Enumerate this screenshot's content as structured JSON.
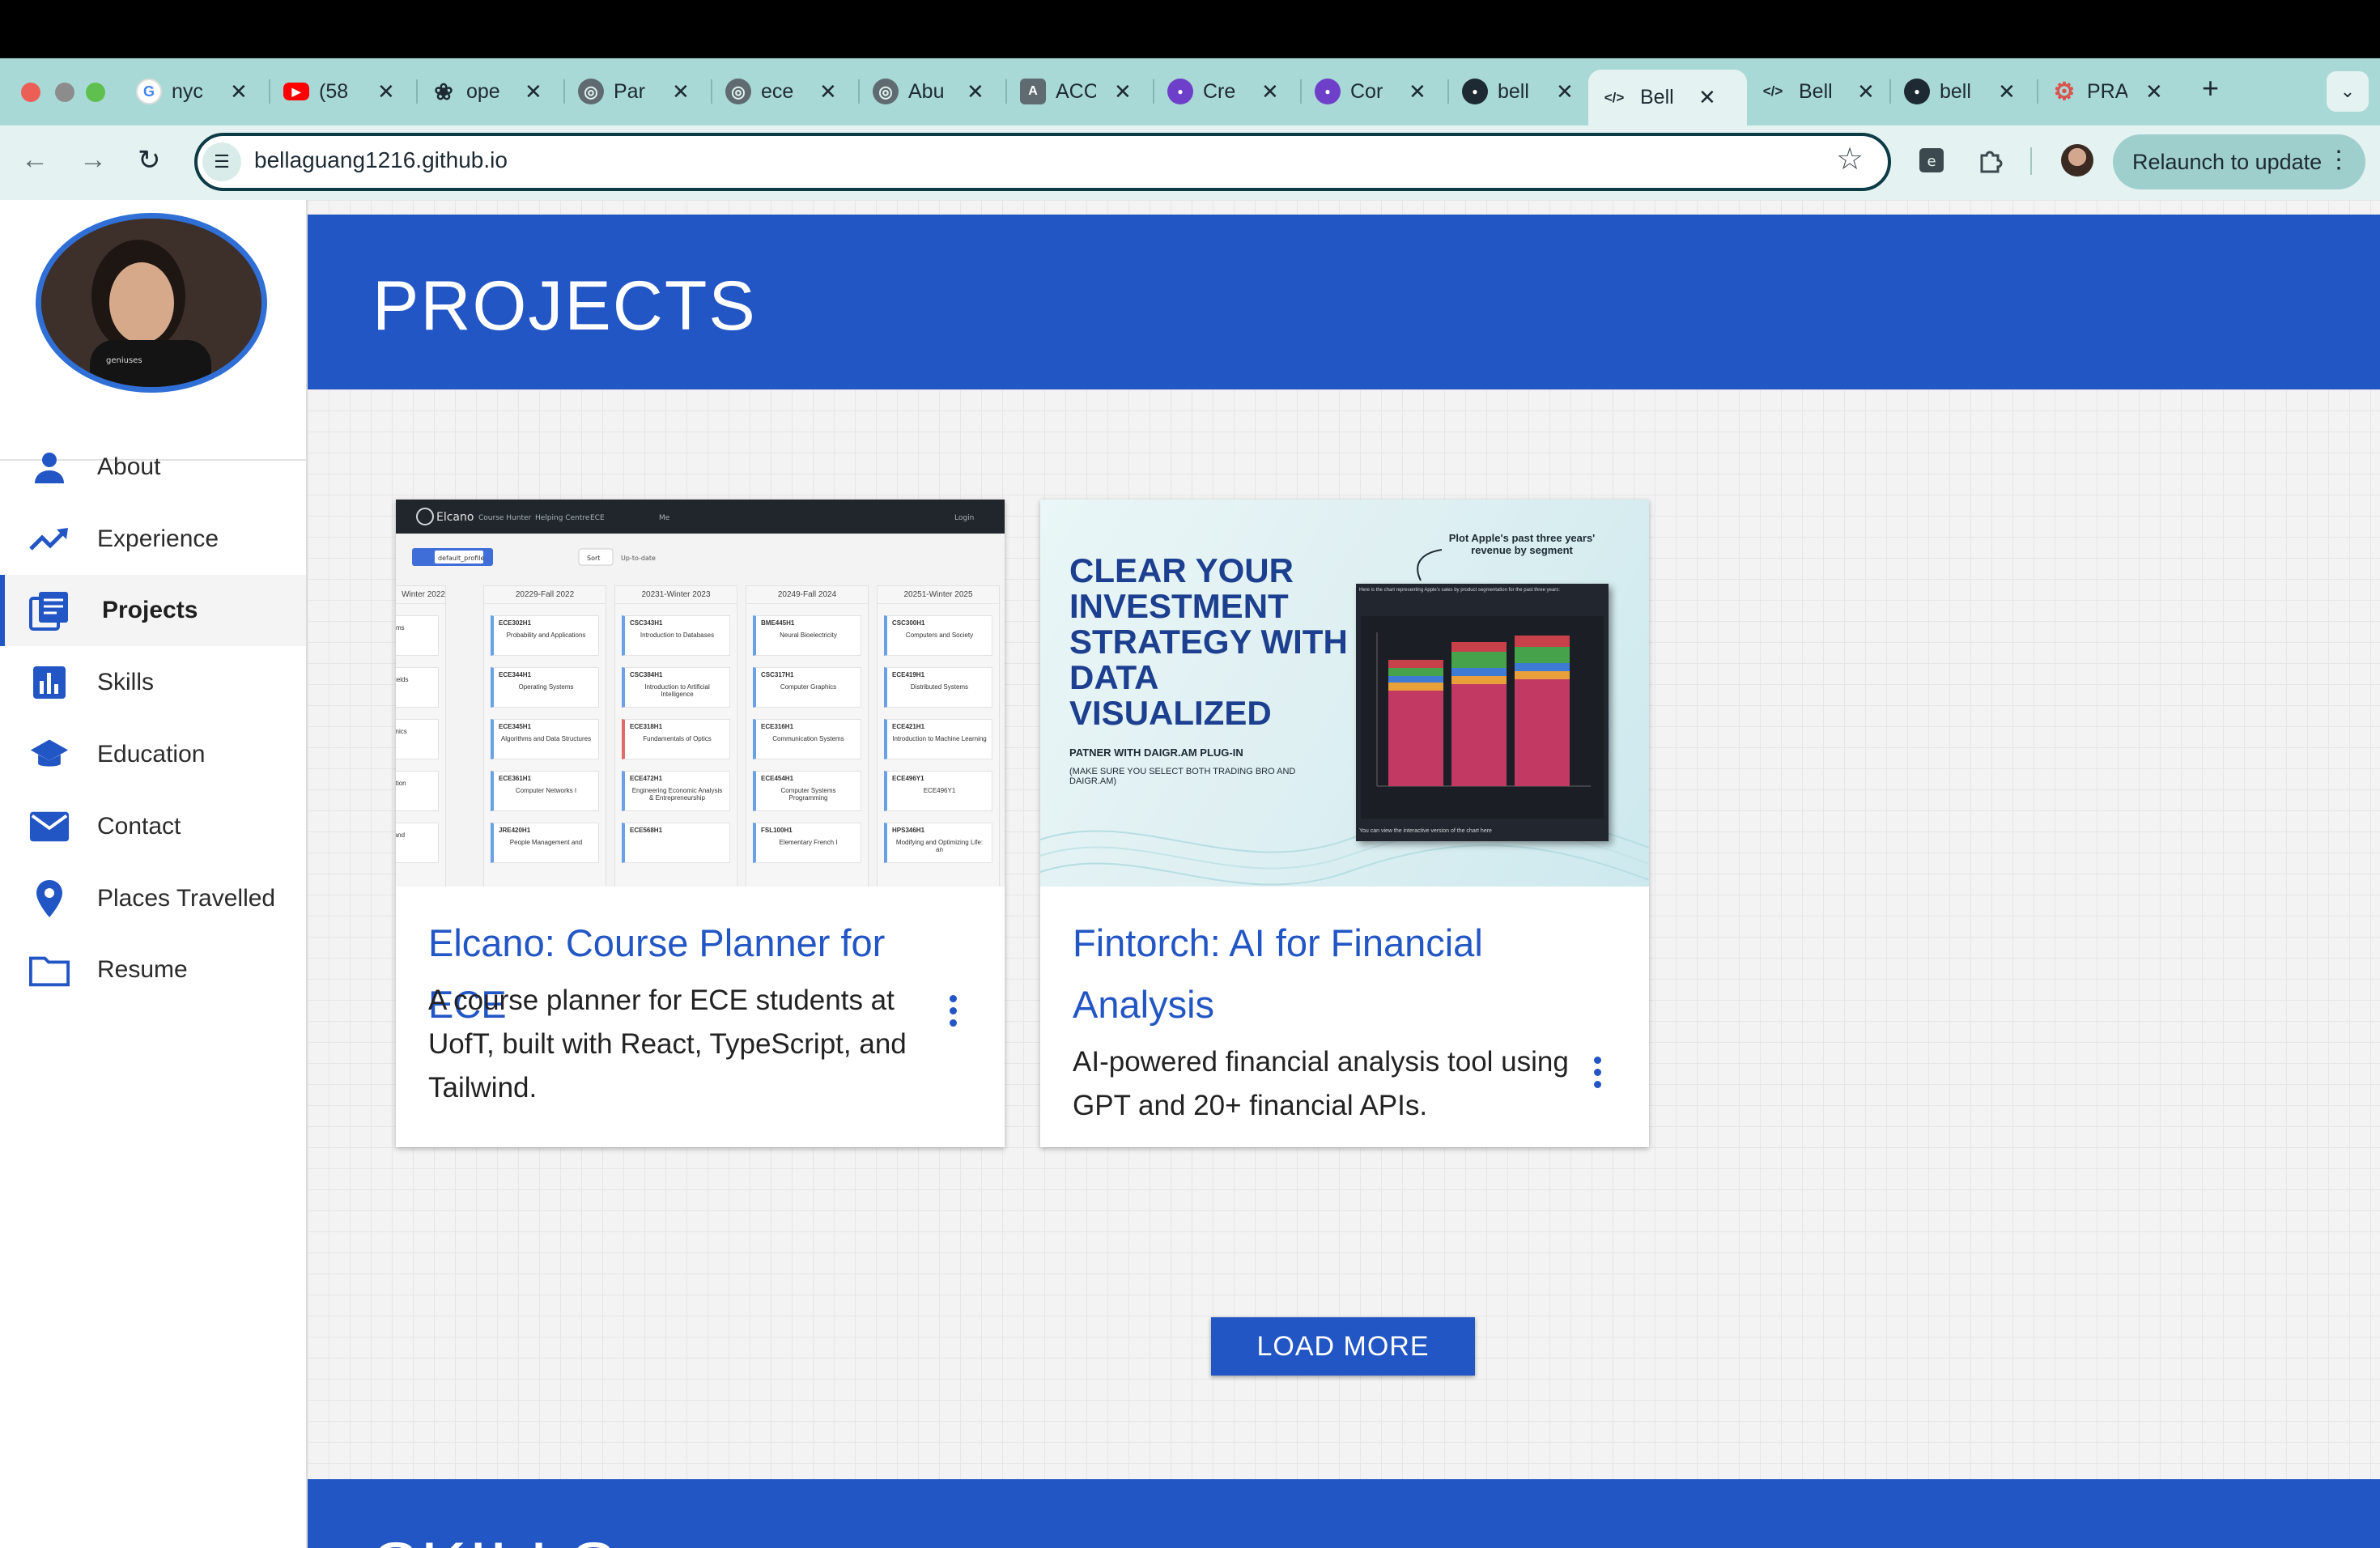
{
  "browser": {
    "tabs": [
      {
        "title": "nyc",
        "icon": "google-icon",
        "color": "#ffffff"
      },
      {
        "title": "(58",
        "icon": "youtube-icon",
        "color": "#ff0000"
      },
      {
        "title": "ope",
        "icon": "openai-icon",
        "color": "#1d2a33"
      },
      {
        "title": "Par",
        "icon": "globe-icon",
        "color": "#5f6b70"
      },
      {
        "title": "ece",
        "icon": "globe-icon",
        "color": "#5f6b70"
      },
      {
        "title": "Abu",
        "icon": "globe-icon",
        "color": "#5f6b70"
      },
      {
        "title": "ACC",
        "icon": "acc-icon",
        "color": "#5f6b70"
      },
      {
        "title": "Cre",
        "icon": "github-icon",
        "color": "#6e40c9"
      },
      {
        "title": "Cor",
        "icon": "github-icon",
        "color": "#6e40c9"
      },
      {
        "title": "bell",
        "icon": "github-icon",
        "color": "#1d2a33"
      },
      {
        "title": "Bell",
        "icon": "code-icon",
        "color": "#1d2a33",
        "active": true
      },
      {
        "title": "Bell",
        "icon": "code-icon",
        "color": "#1d2a33"
      },
      {
        "title": "bell",
        "icon": "github-icon",
        "color": "#1d2a33"
      },
      {
        "title": "PRA",
        "icon": "gear-icon",
        "color": "#d9534f"
      }
    ],
    "url": "bellaguang1216.github.io",
    "relaunch_label": "Relaunch to update"
  },
  "sidebar": {
    "items": [
      {
        "label": "About",
        "icon": "person-icon"
      },
      {
        "label": "Experience",
        "icon": "trending-up-icon"
      },
      {
        "label": "Projects",
        "icon": "library-icon",
        "active": true
      },
      {
        "label": "Skills",
        "icon": "bar-chart-icon"
      },
      {
        "label": "Education",
        "icon": "graduation-cap-icon"
      },
      {
        "label": "Contact",
        "icon": "mail-icon"
      },
      {
        "label": "Places Travelled",
        "icon": "location-pin-icon"
      },
      {
        "label": "Resume",
        "icon": "folder-icon"
      }
    ]
  },
  "projects": {
    "heading": "PROJECTS",
    "cards": [
      {
        "title": "Elcano: Course Planner for ECE",
        "description": "A course planner for ECE students at UofT, built with React, TypeScript, and Tailwind.",
        "thumb": {
          "brand": "Elcano",
          "nav": [
            "Course Hunter",
            "Helping Centre",
            "ECE",
            "Me"
          ],
          "login": "Login",
          "profile": "default_profile",
          "status": "Up-to-date",
          "columns": [
            {
              "term": "Winter 2022",
              "courses": [
                {
                  "code": "",
                  "name": "and Systems"
                },
                {
                  "code": "",
                  "name": "Magnetic Fields"
                },
                {
                  "code": "",
                  "name": "ory Electronics"
                },
                {
                  "code": "",
                  "name": "r Organization"
                },
                {
                  "code": "",
                  "name": "e Design and"
                }
              ]
            },
            {
              "term": "20229-Fall 2022",
              "courses": [
                {
                  "code": "ECE302H1",
                  "name": "Probability and Applications"
                },
                {
                  "code": "ECE344H1",
                  "name": "Operating Systems"
                },
                {
                  "code": "ECE345H1",
                  "name": "Algorithms and Data Structures"
                },
                {
                  "code": "ECE361H1",
                  "name": "Computer Networks I"
                },
                {
                  "code": "JRE420H1",
                  "name": "People Management and"
                }
              ]
            },
            {
              "term": "20231-Winter 2023",
              "courses": [
                {
                  "code": "CSC343H1",
                  "name": "Introduction to Databases"
                },
                {
                  "code": "CSC384H1",
                  "name": "Introduction to Artificial Intelligence"
                },
                {
                  "code": "ECE318H1",
                  "name": "Fundamentals of Optics"
                },
                {
                  "code": "ECE472H1",
                  "name": "Engineering Economic Analysis & Entrepreneurship"
                },
                {
                  "code": "ECE568H1",
                  "name": ""
                }
              ]
            },
            {
              "term": "20249-Fall 2024",
              "courses": [
                {
                  "code": "BME445H1",
                  "name": "Neural Bioelectricity"
                },
                {
                  "code": "CSC317H1",
                  "name": "Computer Graphics"
                },
                {
                  "code": "ECE316H1",
                  "name": "Communication Systems"
                },
                {
                  "code": "ECE454H1",
                  "name": "Computer Systems Programming"
                },
                {
                  "code": "FSL100H1",
                  "name": "Elementary French I"
                }
              ]
            },
            {
              "term": "20251-Winter 2025",
              "courses": [
                {
                  "code": "CSC300H1",
                  "name": "Computers and Society"
                },
                {
                  "code": "ECE419H1",
                  "name": "Distributed Systems"
                },
                {
                  "code": "ECE421H1",
                  "name": "Introduction to Machine Learning"
                },
                {
                  "code": "ECE496Y1",
                  "name": "ECE496Y1"
                },
                {
                  "code": "HPS346H1",
                  "name": "Modifying and Optimizing Life: an"
                }
              ]
            }
          ]
        }
      },
      {
        "title": "Fintorch: AI for Financial Analysis",
        "description": "AI-powered financial analysis tool using GPT and 20+ financial APIs.",
        "thumb": {
          "headline": "CLEAR YOUR INVESTMENT STRATEGY WITH DATA VISUALIZED",
          "partner": "PATNER WITH DAIGR.AM PLUG-IN",
          "note": "(MAKE SURE YOU SELECT BOTH TRADING BRO AND DAIGR.AM)",
          "callout": "Plot Apple's past three years' revenue by segment",
          "chart_caption": "Here is the chart representing Apple's sales by product segmentation for the past three years:",
          "chart_footer": "You can view the interactive version of the chart here"
        }
      }
    ],
    "load_more": "LOAD MORE"
  },
  "skills": {
    "heading": "SKILLS"
  }
}
